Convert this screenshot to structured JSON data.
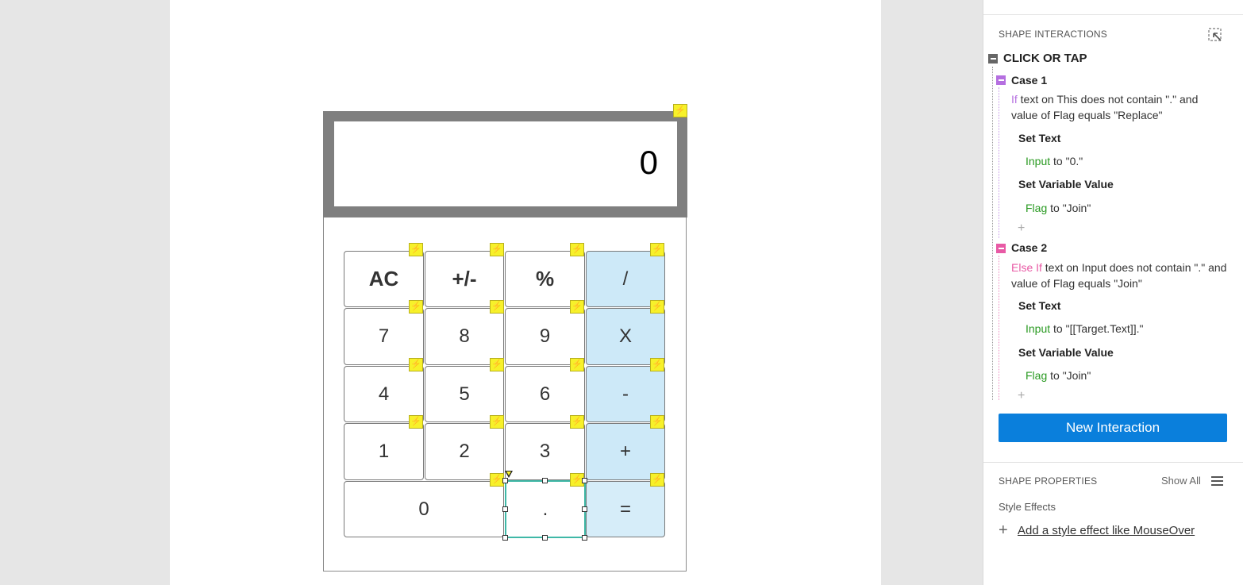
{
  "canvas": {
    "display_value": "0",
    "keys": [
      {
        "id": "ac",
        "label": "AC"
      },
      {
        "id": "sign",
        "label": "+/-"
      },
      {
        "id": "percent",
        "label": "%"
      },
      {
        "id": "divide",
        "label": "/"
      },
      {
        "id": "seven",
        "label": "7"
      },
      {
        "id": "eight",
        "label": "8"
      },
      {
        "id": "nine",
        "label": "9"
      },
      {
        "id": "multiply",
        "label": "X"
      },
      {
        "id": "four",
        "label": "4"
      },
      {
        "id": "five",
        "label": "5"
      },
      {
        "id": "six",
        "label": "6"
      },
      {
        "id": "minus",
        "label": "-"
      },
      {
        "id": "one",
        "label": "1"
      },
      {
        "id": "two",
        "label": "2"
      },
      {
        "id": "three",
        "label": "3"
      },
      {
        "id": "plus",
        "label": "+"
      },
      {
        "id": "zero",
        "label": "0"
      },
      {
        "id": "dot",
        "label": "."
      },
      {
        "id": "equals",
        "label": "="
      }
    ],
    "interaction_marker_icon": "lightning-bolt-icon",
    "accent_colors": {
      "operator_key": "#cde9f8",
      "marker": "#f7f12a",
      "selection": "#3fb8a7"
    }
  },
  "panel": {
    "section_title": "SHAPE INTERACTIONS",
    "event_label": "CLICK OR TAP",
    "cases": [
      {
        "name": "Case 1",
        "condition_keyword": "If",
        "condition_text": " text on This does not contain \".\" and value of Flag equals \"Replace\"",
        "actions": [
          {
            "title": "Set Text",
            "target": "Input",
            "detail": " to \"0.\""
          },
          {
            "title": "Set Variable Value",
            "target": "Flag",
            "detail": " to \"Join\""
          }
        ]
      },
      {
        "name": "Case 2",
        "condition_keyword": "Else If",
        "condition_text": " text on Input does not contain \".\" and value of Flag equals \"Join\"",
        "actions": [
          {
            "title": "Set Text",
            "target": "Input",
            "detail": " to \"[[Target.Text]].\""
          },
          {
            "title": "Set Variable Value",
            "target": "Flag",
            "detail": " to \"Join\""
          }
        ]
      }
    ],
    "add_action_symbol": "+",
    "new_interaction_label": "New Interaction",
    "properties_title": "SHAPE PROPERTIES",
    "show_all_label": "Show All",
    "style_effects_label": "Style Effects",
    "add_effect_symbol": "+",
    "add_effect_label": "Add a style effect like MouseOver",
    "colors": {
      "button": "#0a7fdc",
      "if": "#b56fe0",
      "else_if": "#e85aa5",
      "target": "#2a9a22"
    }
  }
}
